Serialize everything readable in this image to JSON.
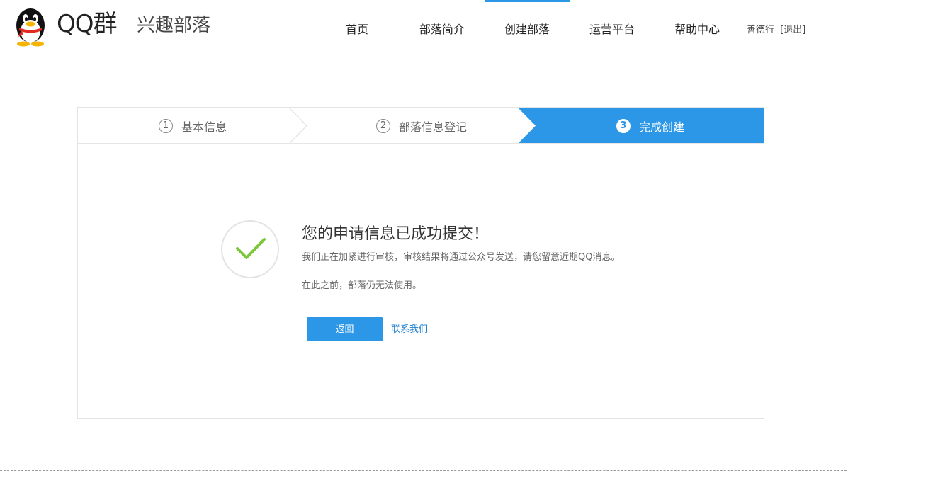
{
  "header": {
    "brand_main": "QQ群",
    "brand_sub": "兴趣部落",
    "nav": [
      {
        "label": "首页"
      },
      {
        "label": "部落简介"
      },
      {
        "label": "创建部落"
      },
      {
        "label": "运营平台"
      },
      {
        "label": "帮助中心"
      }
    ],
    "active_nav": "创建部落",
    "username": "善德行",
    "logout_label": "[退出]"
  },
  "steps": [
    {
      "number": "1",
      "label": "基本信息"
    },
    {
      "number": "2",
      "label": "部落信息登记"
    },
    {
      "number": "3",
      "label": "完成创建"
    }
  ],
  "active_step": "3",
  "result": {
    "title": "您的申请信息已成功提交！",
    "description": "我们正在加紧进行审核，审核结果将通过公众号发送，请您留意近期QQ消息。",
    "description2": "在此之前，部落仍无法使用。",
    "back_button": "返回",
    "contact_link": "联系我们"
  },
  "colors": {
    "accent": "#2b97e6",
    "success": "#7cc63b",
    "link": "#1f7fd0"
  }
}
